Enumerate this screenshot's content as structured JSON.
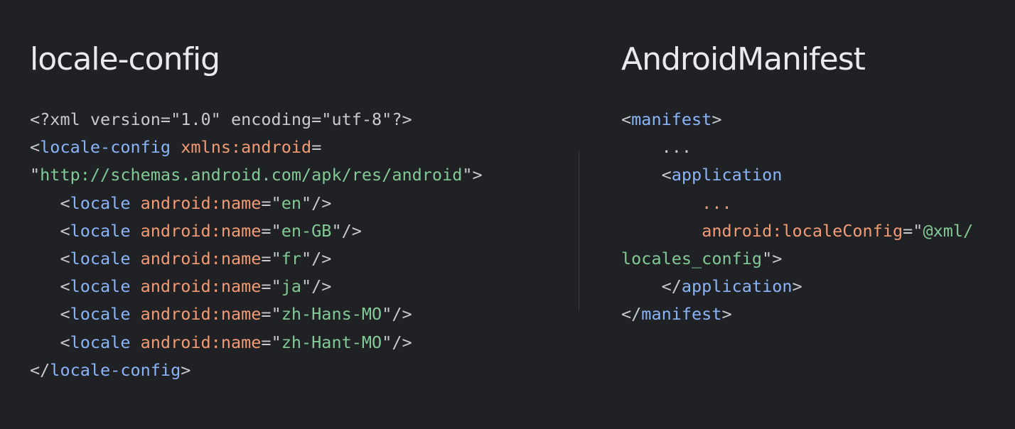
{
  "colors": {
    "background": "#202124",
    "heading": "#e8eaed",
    "punctuation": "#c7cad1",
    "tag": "#8ab4f8",
    "attribute": "#f29b74",
    "string": "#81c995"
  },
  "left_panel": {
    "title": "locale-config",
    "lines": [
      [
        {
          "t": "<?xml version=\"1.0\" encoding=\"utf-8\"?>",
          "c": "punctuation"
        }
      ],
      [
        {
          "t": "<",
          "c": "punctuation"
        },
        {
          "t": "locale-config",
          "c": "tag"
        },
        {
          "t": " ",
          "c": "punctuation"
        },
        {
          "t": "xmlns:android",
          "c": "attribute"
        },
        {
          "t": "=",
          "c": "punctuation"
        }
      ],
      [
        {
          "t": "\"",
          "c": "punctuation"
        },
        {
          "t": "http://schemas.android.com/apk/res/android",
          "c": "string"
        },
        {
          "t": "\">",
          "c": "punctuation"
        }
      ],
      [
        {
          "t": "   <",
          "c": "punctuation"
        },
        {
          "t": "locale",
          "c": "tag"
        },
        {
          "t": " ",
          "c": "punctuation"
        },
        {
          "t": "android:name",
          "c": "attribute"
        },
        {
          "t": "=\"",
          "c": "punctuation"
        },
        {
          "t": "en",
          "c": "string"
        },
        {
          "t": "\"/>",
          "c": "punctuation"
        }
      ],
      [
        {
          "t": "   <",
          "c": "punctuation"
        },
        {
          "t": "locale",
          "c": "tag"
        },
        {
          "t": " ",
          "c": "punctuation"
        },
        {
          "t": "android:name",
          "c": "attribute"
        },
        {
          "t": "=\"",
          "c": "punctuation"
        },
        {
          "t": "en-GB",
          "c": "string"
        },
        {
          "t": "\"/>",
          "c": "punctuation"
        }
      ],
      [
        {
          "t": "   <",
          "c": "punctuation"
        },
        {
          "t": "locale",
          "c": "tag"
        },
        {
          "t": " ",
          "c": "punctuation"
        },
        {
          "t": "android:name",
          "c": "attribute"
        },
        {
          "t": "=\"",
          "c": "punctuation"
        },
        {
          "t": "fr",
          "c": "string"
        },
        {
          "t": "\"/>",
          "c": "punctuation"
        }
      ],
      [
        {
          "t": "   <",
          "c": "punctuation"
        },
        {
          "t": "locale",
          "c": "tag"
        },
        {
          "t": " ",
          "c": "punctuation"
        },
        {
          "t": "android:name",
          "c": "attribute"
        },
        {
          "t": "=\"",
          "c": "punctuation"
        },
        {
          "t": "ja",
          "c": "string"
        },
        {
          "t": "\"/>",
          "c": "punctuation"
        }
      ],
      [
        {
          "t": "   <",
          "c": "punctuation"
        },
        {
          "t": "locale",
          "c": "tag"
        },
        {
          "t": " ",
          "c": "punctuation"
        },
        {
          "t": "android:name",
          "c": "attribute"
        },
        {
          "t": "=\"",
          "c": "punctuation"
        },
        {
          "t": "zh-Hans-MO",
          "c": "string"
        },
        {
          "t": "\"/>",
          "c": "punctuation"
        }
      ],
      [
        {
          "t": "   <",
          "c": "punctuation"
        },
        {
          "t": "locale",
          "c": "tag"
        },
        {
          "t": " ",
          "c": "punctuation"
        },
        {
          "t": "android:name",
          "c": "attribute"
        },
        {
          "t": "=\"",
          "c": "punctuation"
        },
        {
          "t": "zh-Hant-MO",
          "c": "string"
        },
        {
          "t": "\"/>",
          "c": "punctuation"
        }
      ],
      [
        {
          "t": "</",
          "c": "punctuation"
        },
        {
          "t": "locale-config",
          "c": "tag"
        },
        {
          "t": ">",
          "c": "punctuation"
        }
      ]
    ]
  },
  "right_panel": {
    "title": "AndroidManifest",
    "lines": [
      [
        {
          "t": "<",
          "c": "punctuation"
        },
        {
          "t": "manifest",
          "c": "tag"
        },
        {
          "t": ">",
          "c": "punctuation"
        }
      ],
      [
        {
          "t": "    ...",
          "c": "punctuation"
        }
      ],
      [
        {
          "t": "    <",
          "c": "punctuation"
        },
        {
          "t": "application",
          "c": "tag"
        }
      ],
      [
        {
          "t": "        ...",
          "c": "attribute"
        }
      ],
      [
        {
          "t": "        ",
          "c": "punctuation"
        },
        {
          "t": "android:localeConfig",
          "c": "attribute"
        },
        {
          "t": "=\"",
          "c": "punctuation"
        },
        {
          "t": "@xml/",
          "c": "string"
        }
      ],
      [
        {
          "t": "locales_config",
          "c": "string"
        },
        {
          "t": "\">",
          "c": "punctuation"
        }
      ],
      [
        {
          "t": "    </",
          "c": "punctuation"
        },
        {
          "t": "application",
          "c": "tag"
        },
        {
          "t": ">",
          "c": "punctuation"
        }
      ],
      [
        {
          "t": "</",
          "c": "punctuation"
        },
        {
          "t": "manifest",
          "c": "tag"
        },
        {
          "t": ">",
          "c": "punctuation"
        }
      ]
    ]
  }
}
